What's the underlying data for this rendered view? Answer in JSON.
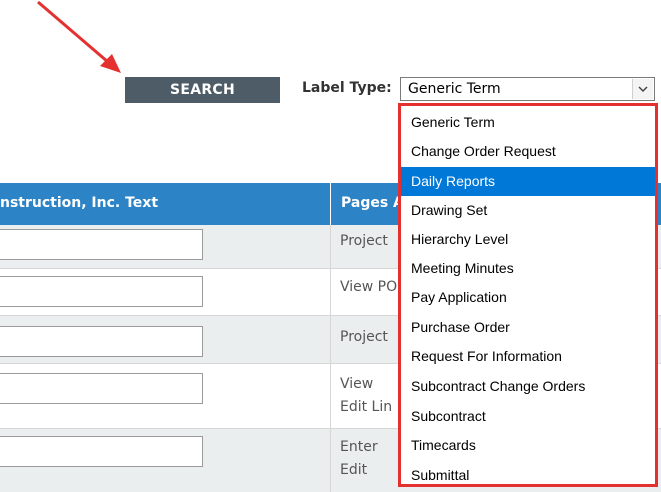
{
  "toolbar": {
    "search_label": "SEARCH",
    "label_type_label": "Label Type:",
    "label_type_value": "Generic Term"
  },
  "table": {
    "col1_header": "nstruction, Inc. Text",
    "col2_header": "Pages A",
    "rows": [
      {
        "pages": [
          "Project"
        ]
      },
      {
        "pages": [
          "View PO"
        ]
      },
      {
        "pages": [
          "Project"
        ]
      },
      {
        "pages": [
          "View",
          "Edit Lin"
        ]
      },
      {
        "pages": [
          "Enter",
          "Edit"
        ]
      }
    ]
  },
  "dropdown": {
    "options": [
      "Generic Term",
      "Change Order Request",
      "Daily Reports",
      "Drawing Set",
      "Hierarchy Level",
      "Meeting Minutes",
      "Pay Application",
      "Purchase Order",
      "Request For Information",
      "Subcontract Change Orders",
      "Subcontract",
      "Timecards",
      "Submittal"
    ],
    "highlighted": "Daily Reports"
  },
  "colors": {
    "header_blue": "#2c84c6",
    "search_button": "#4d5c66",
    "highlight_blue": "#0078d7",
    "annotation_red": "#e53030"
  },
  "icons": {
    "select_arrow": "chevron-down-icon",
    "annotation": "arrow-annotation-icon"
  }
}
